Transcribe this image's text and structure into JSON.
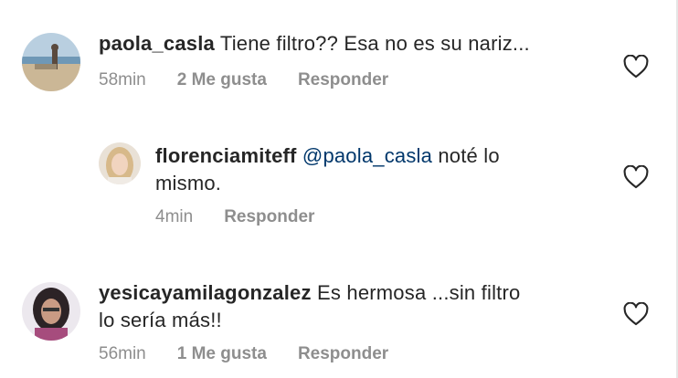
{
  "comments": [
    {
      "username": "paola_casla",
      "mention": "",
      "text": "Tiene filtro?? Esa no es su nariz...",
      "time": "58min",
      "likes": "2 Me gusta",
      "reply": "Responder",
      "avatar": "avatar-beach-photo",
      "heart": "heart-outline-icon"
    },
    {
      "username": "florenciamiteff",
      "mention": "@paola_casla",
      "text_line1": "noté lo",
      "text_line2": "mismo.",
      "time": "4min",
      "reply": "Responder",
      "avatar": "avatar-portrait-blonde",
      "heart": "heart-outline-icon"
    },
    {
      "username": "yesicayamilagonzalez",
      "mention": "",
      "text_line1": "Es hermosa ...sin filtro",
      "text_line2": "lo sería más!!",
      "time": "56min",
      "likes": "1 Me gusta",
      "reply": "Responder",
      "avatar": "avatar-portrait-dark-hair",
      "heart": "heart-outline-icon"
    }
  ],
  "colors": {
    "text": "#262626",
    "meta": "#8e8e8e",
    "mention": "#00376b",
    "background": "#ffffff"
  }
}
